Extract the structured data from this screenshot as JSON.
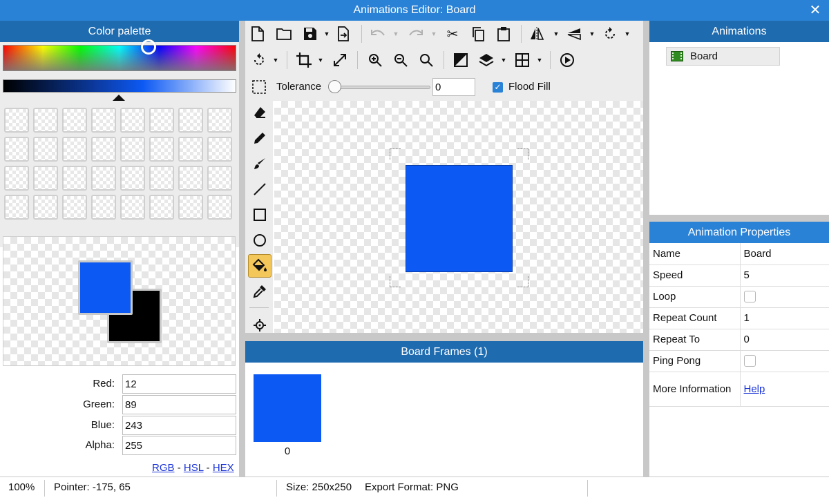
{
  "window": {
    "title": "Animations Editor: Board",
    "close_glyph": "✕"
  },
  "palette": {
    "header": "Color palette",
    "swatch_count": 32
  },
  "color": {
    "primary_hex": "#0c59f3",
    "secondary_hex": "#000000",
    "red_label": "Red:",
    "red_value": "12",
    "green_label": "Green:",
    "green_value": "89",
    "blue_label": "Blue:",
    "blue_value": "243",
    "alpha_label": "Alpha:",
    "alpha_value": "255",
    "format_rgb": "RGB",
    "format_hsl": "HSL",
    "format_hex": "HEX",
    "format_sep": "-"
  },
  "toolbar": {
    "row1_icons": [
      "new-file-icon",
      "open-folder-icon",
      "save-icon",
      "export-icon",
      "undo-icon",
      "redo-icon",
      "cut-icon",
      "copy-icon",
      "paste-icon",
      "flip-horizontal-icon",
      "flip-vertical-icon",
      "rotate-icon"
    ],
    "row2_icons": [
      "rotate-right-icon",
      "crop-icon",
      "resize-icon",
      "zoom-in-icon",
      "zoom-out-icon",
      "zoom-fit-icon",
      "invert-colors-icon",
      "layers-icon",
      "grid-icon",
      "play-icon"
    ],
    "tolerance_label": "Tolerance",
    "tolerance_value": "0",
    "tolerance_level": 0,
    "flood_fill_label": "Flood Fill",
    "flood_fill_checked": true
  },
  "tools": {
    "items": [
      "eraser-icon",
      "pencil-icon",
      "brush-icon",
      "line-icon",
      "rectangle-icon",
      "ellipse-icon",
      "fill-bucket-icon",
      "eyedropper-icon",
      "move-origin-icon"
    ],
    "active": "fill-bucket-icon"
  },
  "canvas": {
    "fill_hex": "#0c59f3"
  },
  "frames": {
    "header": "Board Frames (1)",
    "items": [
      {
        "label": "0"
      }
    ]
  },
  "animations": {
    "header": "Animations",
    "items": [
      {
        "label": "Board",
        "icon": "film-icon"
      }
    ]
  },
  "properties": {
    "header": "Animation Properties",
    "rows": [
      {
        "key": "Name",
        "value": "Board"
      },
      {
        "key": "Speed",
        "value": "5"
      },
      {
        "key": "Loop",
        "checked": false
      },
      {
        "key": "Repeat Count",
        "value": "1"
      },
      {
        "key": "Repeat To",
        "value": "0"
      },
      {
        "key": "Ping Pong",
        "checked": false
      },
      {
        "key": "More Information",
        "link": "Help"
      }
    ]
  },
  "status": {
    "zoom": "100%",
    "pointer": "Pointer: -175, 65",
    "size": "Size: 250x250",
    "export_format": "Export Format: PNG"
  }
}
